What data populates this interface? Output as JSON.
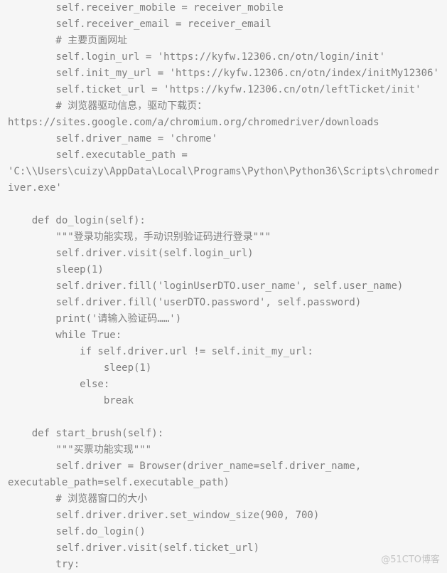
{
  "code_lines": [
    "        self.receiver_mobile = receiver_mobile",
    "        self.receiver_email = receiver_email",
    "        # 主要页面网址",
    "        self.login_url = 'https://kyfw.12306.cn/otn/login/init'",
    "        self.init_my_url = 'https://kyfw.12306.cn/otn/index/initMy12306'",
    "        self.ticket_url = 'https://kyfw.12306.cn/otn/leftTicket/init'",
    "        # 浏览器驱动信息，驱动下载页：",
    "https://sites.google.com/a/chromium.org/chromedriver/downloads",
    "        self.driver_name = 'chrome'",
    "        self.executable_path =",
    "'C:\\\\Users\\cuizy\\AppData\\Local\\Programs\\Python\\Python36\\Scripts\\chromedr",
    "iver.exe'",
    "",
    "    def do_login(self):",
    "        \"\"\"登录功能实现，手动识别验证码进行登录\"\"\"",
    "        self.driver.visit(self.login_url)",
    "        sleep(1)",
    "        self.driver.fill('loginUserDTO.user_name', self.user_name)",
    "        self.driver.fill('userDTO.password', self.password)",
    "        print('请输入验证码……')",
    "        while True:",
    "            if self.driver.url != self.init_my_url:",
    "                sleep(1)",
    "            else:",
    "                break",
    "",
    "    def start_brush(self):",
    "        \"\"\"买票功能实现\"\"\"",
    "        self.driver = Browser(driver_name=self.driver_name,",
    "executable_path=self.executable_path)",
    "        # 浏览器窗口的大小",
    "        self.driver.driver.set_window_size(900, 700)",
    "        self.do_login()",
    "        self.driver.visit(self.ticket_url)",
    "        try:"
  ],
  "watermark": "@51CTO博客"
}
